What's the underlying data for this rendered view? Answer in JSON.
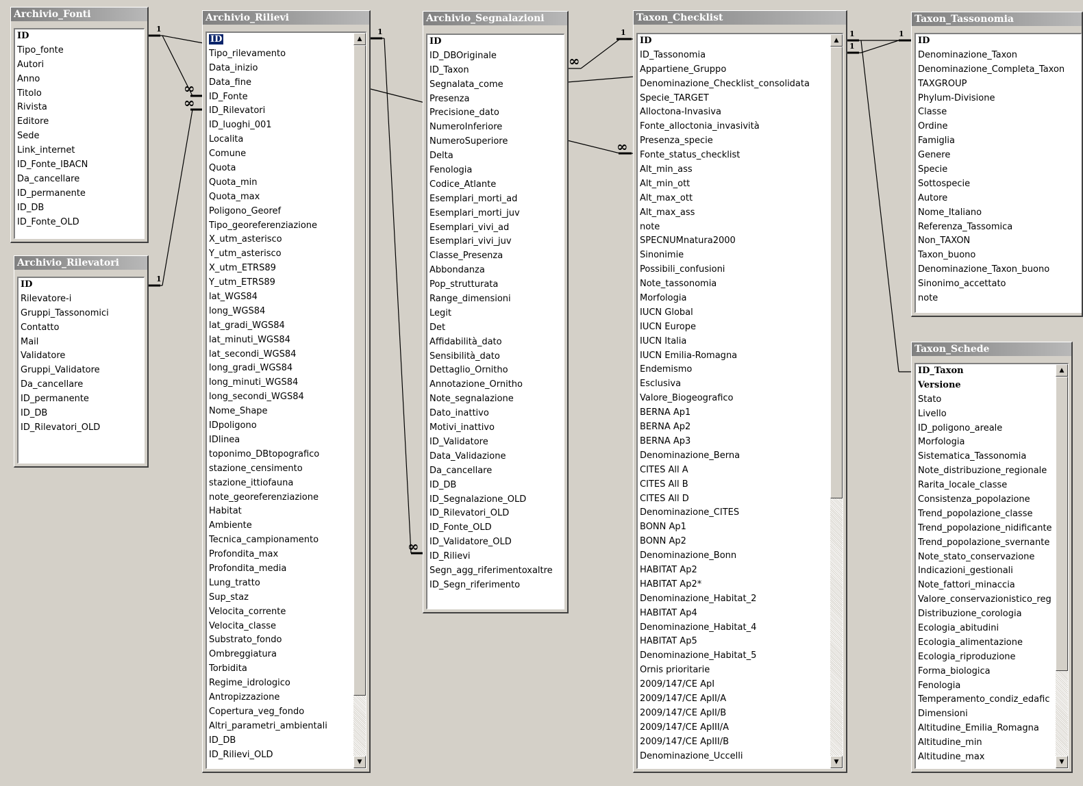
{
  "tables": {
    "fonti": {
      "title": "Archivio_Fonti",
      "fields": [
        "ID",
        "Tipo_fonte",
        "Autori",
        "Anno",
        "Titolo",
        "Rivista",
        "Editore",
        "Sede",
        "Link_internet",
        "ID_Fonte_IBACN",
        "Da_cancellare",
        "ID_permanente",
        "ID_DB",
        "ID_Fonte_OLD"
      ]
    },
    "rilevatori": {
      "title": "Archivio_Rilevatori",
      "fields": [
        "ID",
        "Rilevatore-i",
        "Gruppi_Tassonomici",
        "Contatto",
        "Mail",
        "Validatore",
        "Gruppi_Validatore",
        "Da_cancellare",
        "ID_permanente",
        "ID_DB",
        "ID_Rilevatori_OLD"
      ]
    },
    "rilievi": {
      "title": "Archivio_Rilievi",
      "fields": [
        "ID",
        "Tipo_rilevamento",
        "Data_inizio",
        "Data_fine",
        "ID_Fonte",
        "ID_Rilevatori",
        "ID_luoghi_001",
        "Localita",
        "Comune",
        "Quota",
        "Quota_min",
        "Quota_max",
        "Poligono_Georef",
        "Tipo_georeferenziazione",
        "X_utm_asterisco",
        "Y_utm_asterisco",
        "X_utm_ETRS89",
        "Y_utm_ETRS89",
        "lat_WGS84",
        "long_WGS84",
        "lat_gradi_WGS84",
        "lat_minuti_WGS84",
        "lat_secondi_WGS84",
        "long_gradi_WGS84",
        "long_minuti_WGS84",
        "long_secondi_WGS84",
        "Nome_Shape",
        "IDpoligono",
        "IDlinea",
        "toponimo_DBtopografico",
        "stazione_censimento",
        "stazione_ittiofauna",
        "note_georeferenziazione",
        "Habitat",
        "Ambiente",
        "Tecnica_campionamento",
        "Profondita_max",
        "Profondita_media",
        "Lung_tratto",
        "Sup_staz",
        "Velocita_corrente",
        "Velocita_classe",
        "Substrato_fondo",
        "Ombreggiatura",
        "Torbidita",
        "Regime_idrologico",
        "Antropizzazione",
        "Copertura_veg_fondo",
        "Altri_parametri_ambientali",
        "ID_DB",
        "ID_Rilievi_OLD"
      ]
    },
    "segnalazioni": {
      "title": "Archivio_Segnalazioni",
      "fields": [
        "ID",
        "ID_DBOriginale",
        "ID_Taxon",
        "Segnalata_come",
        "Presenza",
        "Precisione_dato",
        "NumeroInferiore",
        "NumeroSuperiore",
        "Delta",
        "Fenologia",
        "Codice_Atlante",
        "Esemplari_morti_ad",
        "Esemplari_morti_juv",
        "Esemplari_vivi_ad",
        "Esemplari_vivi_juv",
        "Classe_Presenza",
        "Abbondanza",
        "Pop_strutturata",
        "Range_dimensioni",
        "Legit",
        "Det",
        "Affidabilità_dato",
        "Sensibilità_dato",
        "Dettaglio_Ornitho",
        "Annotazione_Ornitho",
        "Note_segnalazione",
        "Dato_inattivo",
        "Motivi_inattivo",
        "ID_Validatore",
        "Data_Validazione",
        "Da_cancellare",
        "ID_DB",
        "ID_Segnalazione_OLD",
        "ID_Rilevatori_OLD",
        "ID_Fonte_OLD",
        "ID_Validatore_OLD",
        "ID_Rilievi",
        "Segn_agg_riferimentoxaltre",
        "ID_Segn_riferimento"
      ]
    },
    "checklist": {
      "title": "Taxon_Checklist",
      "fields": [
        "ID",
        "ID_Tassonomia",
        "Appartiene_Gruppo",
        "Denominazione_Checklist_consolidata",
        "Specie_TARGET",
        "Alloctona-Invasiva",
        "Fonte_alloctonia_invasività",
        "Presenza_specie",
        "Fonte_status_checklist",
        "Alt_min_ass",
        "Alt_min_ott",
        "Alt_max_ott",
        "Alt_max_ass",
        "note",
        "SPECNUMnatura2000",
        "Sinonimie",
        "Possibili_confusioni",
        "Note_tassonomia",
        "Morfologia",
        "IUCN Global",
        "IUCN Europe",
        "IUCN Italia",
        "IUCN Emilia-Romagna",
        "Endemismo",
        "Esclusiva",
        "Valore_Biogeografico",
        "BERNA Ap1",
        "BERNA Ap2",
        "BERNA Ap3",
        "Denominazione_Berna",
        "CITES All A",
        "CITES All B",
        "CITES All D",
        "Denominazione_CITES",
        "BONN Ap1",
        "BONN Ap2",
        "Denominazione_Bonn",
        "HABITAT Ap2",
        "HABITAT Ap2*",
        "Denominazione_Habitat_2",
        "HABITAT Ap4",
        "Denominazione_Habitat_4",
        "HABITAT Ap5",
        "Denominazione_Habitat_5",
        "Ornis prioritarie",
        "2009/147/CE ApI",
        "2009/147/CE ApII/A",
        "2009/147/CE ApII/B",
        "2009/147/CE ApIII/A",
        "2009/147/CE ApIII/B",
        "Denominazione_Uccelli"
      ]
    },
    "tassonomia": {
      "title": "Taxon_Tassonomia",
      "fields": [
        "ID",
        "Denominazione_Taxon",
        "Denominazione_Completa_Taxon",
        "TAXGROUP",
        "Phylum-Divisione",
        "Classe",
        "Ordine",
        "Famiglia",
        "Genere",
        "Specie",
        "Sottospecie",
        "Autore",
        "Nome_Italiano",
        "Referenza_Tassomica",
        "Non_TAXON",
        "Taxon_buono",
        "Denominazione_Taxon_buono",
        "Sinonimo_accettato",
        "note"
      ]
    },
    "schede": {
      "title": "Taxon_Schede",
      "fields": [
        "ID_Taxon",
        "Versione",
        "Stato",
        "Livello",
        "ID_poligono_areale",
        "Morfologia",
        "Sistematica_Tassonomia",
        "Note_distribuzione_regionale",
        "Rarita_locale_classe",
        "Consistenza_popolazione",
        "Trend_popolazione_classe",
        "Trend_popolazione_nidificante",
        "Trend_popolazione_svernante",
        "Note_stato_conservazione",
        "Indicazioni_gestionali",
        "Note_fattori_minaccia",
        "Valore_conservazionistico_reg",
        "Distribuzione_corologia",
        "Ecologia_abitudini",
        "Ecologia_alimentazione",
        "Ecologia_riproduzione",
        "Forma_biologica",
        "Fenologia",
        "Temperamento_condiz_edafic",
        "Dimensioni",
        "Altitudine_Emilia_Romagna",
        "Altitudine_min",
        "Altitudine_max"
      ]
    }
  },
  "relation_labels": {
    "one": "1",
    "many": "∞"
  },
  "icons": {
    "scroll_up": "arrow-up-icon",
    "scroll_down": "arrow-down-icon"
  }
}
